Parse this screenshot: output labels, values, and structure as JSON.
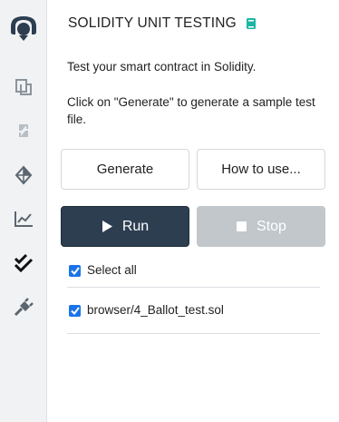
{
  "sidebar": {
    "items": [
      {
        "icon": "remix-logo-icon"
      },
      {
        "icon": "file-explorer-icon"
      },
      {
        "icon": "compiler-icon"
      },
      {
        "icon": "deploy-run-icon"
      },
      {
        "icon": "analysis-chart-icon"
      },
      {
        "icon": "unit-testing-checkmarks-icon",
        "active": true
      },
      {
        "icon": "plugin-manager-icon"
      }
    ]
  },
  "header": {
    "title": "SOLIDITY UNIT TESTING",
    "doc_icon": "book-icon",
    "accent": "#1db6a3"
  },
  "intro": {
    "line1": "Test your smart contract in Solidity.",
    "line2": "Click on \"Generate\" to generate a sample test file."
  },
  "buttons": {
    "generate": "Generate",
    "how_to_use": "How to use...",
    "run": "Run",
    "stop": "Stop"
  },
  "select_all": {
    "label": "Select all",
    "checked": true
  },
  "tests": [
    {
      "label": "browser/4_Ballot_test.sol",
      "checked": true
    }
  ],
  "colors": {
    "run_bg": "#2c3e50",
    "stop_bg": "#c1c7cb",
    "checkbox": "#1a73e8",
    "sidebar_bg": "#f0f2f4"
  }
}
